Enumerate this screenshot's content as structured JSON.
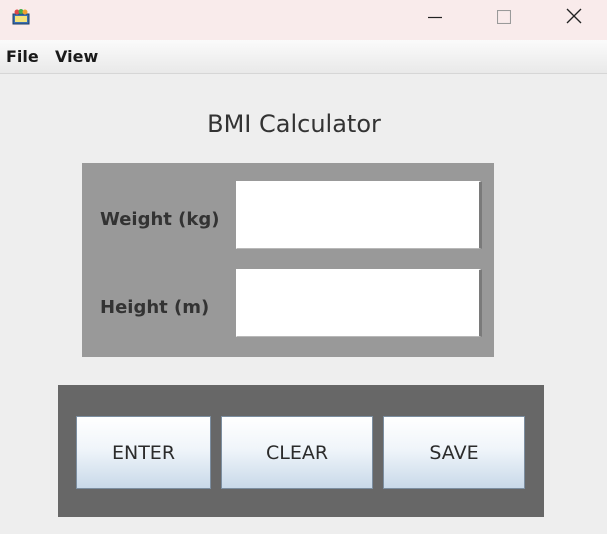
{
  "window": {
    "icon": "app-icon",
    "controls": [
      "minimize-icon",
      "maximize-icon",
      "close-icon"
    ]
  },
  "menu": {
    "file_label": "File",
    "view_label": "View"
  },
  "main": {
    "heading": "BMI Calculator",
    "weight_label": "Weight (kg)",
    "weight_value": "",
    "height_label": "Height (m)",
    "height_value": ""
  },
  "buttons": {
    "enter_label": "ENTER",
    "clear_label": "CLEAR",
    "save_label": "SAVE"
  },
  "colors": {
    "input_panel": "#999999",
    "button_panel": "#676767",
    "title_bar": "#f9ebeb"
  }
}
